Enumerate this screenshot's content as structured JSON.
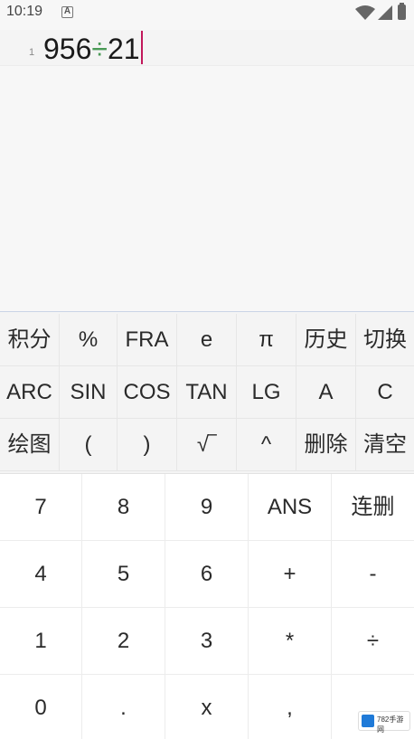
{
  "status_bar": {
    "time": "10:19",
    "notification_icon_letter": "A"
  },
  "display": {
    "line_number": "1",
    "expression_part1": "956",
    "expression_operator": "÷",
    "expression_part2": "21"
  },
  "function_keys": {
    "row1": [
      "积分",
      "%",
      "FRA",
      "e",
      "π",
      "历史",
      "切换"
    ],
    "row2": [
      "ARC",
      "SIN",
      "COS",
      "TAN",
      "LG",
      "A",
      "C"
    ],
    "row3": [
      "绘图",
      "(",
      ")",
      "√‾",
      "^",
      "删除",
      "清空"
    ]
  },
  "number_keys": {
    "row1": [
      "7",
      "8",
      "9",
      "ANS",
      "连删"
    ],
    "row2": [
      "4",
      "5",
      "6",
      "+",
      "-"
    ],
    "row3": [
      "1",
      "2",
      "3",
      "*",
      "÷"
    ],
    "row4": [
      "0",
      ".",
      "x",
      ","
    ]
  },
  "watermark": {
    "text": "782手游网"
  },
  "colors": {
    "background": "#f7f7f7",
    "operator": "#4a9a56",
    "cursor": "#c2185b",
    "keypad_border": "#c9d4e6"
  }
}
